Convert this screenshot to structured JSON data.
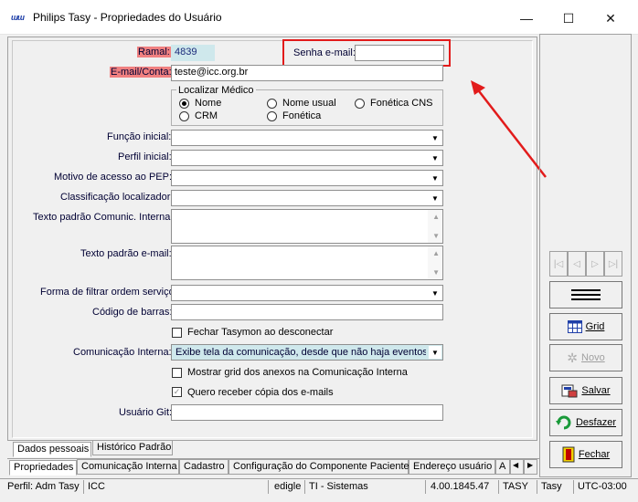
{
  "window": {
    "logo_text": "TASY",
    "title": "Philips Tasy - Propriedades do Usuário",
    "minimize": "—",
    "maximize": "☐",
    "close": "✕"
  },
  "form": {
    "ramal_label": "Ramal:",
    "ramal_value": "4839",
    "senha_label": "Senha e-mail:",
    "senha_value": "",
    "email_label": "E-mail/Conta:",
    "email_value": "teste@icc.org.br",
    "localizar": {
      "legend": "Localizar Médico",
      "options": [
        "Nome",
        "Nome usual",
        "Fonética CNS",
        "CRM",
        "Fonética"
      ],
      "selected": "Nome"
    },
    "funcao_label": "Função inicial:",
    "perfil_label": "Perfil inicial:",
    "motivo_label": "Motivo de acesso ao PEP:",
    "classificacao_label": "Classificação localizador:",
    "texto_comunic_label": "Texto padrão Comunic. Interna:",
    "texto_email_label": "Texto padrão e-mail:",
    "forma_filtrar_label": "Forma de filtrar ordem serviço:",
    "codigo_barras_label": "Código de barras:",
    "fechar_tasymon_label": "Fechar Tasymon ao desconectar",
    "comunicacao_label": "Comunicação Interna:",
    "comunicacao_value": "Exibe tela da comunicação, desde que não haja eventos c",
    "mostrar_grid_label": "Mostrar grid dos anexos na Comunicação Interna",
    "quero_copia_label": "Quero receber cópia dos e-mails",
    "usuario_git_label": "Usuário Git:"
  },
  "inner_tabs": [
    "Dados pessoais",
    "Histórico Padrão"
  ],
  "bottom_tabs": [
    "Propriedades",
    "Comunicação Interna",
    "Cadastro",
    "Configuração do Componente Paciente",
    "Endereço usuário",
    "A"
  ],
  "side_buttons": {
    "grid": "Grid",
    "novo": "Novo",
    "salvar": "Salvar",
    "desfazer": "Desfazer",
    "fechar": "Fechar"
  },
  "statusbar": {
    "perfil": "Perfil: Adm Tasy",
    "estab": "ICC",
    "user": "edigle",
    "setor": "TI - Sistemas",
    "version": "4.00.1845.47",
    "db": "TASY",
    "schema": "Tasy",
    "tz": "UTC-03:00"
  },
  "colors": {
    "highlight_label": "#f08080",
    "annotation_red": "#e21b1b"
  }
}
